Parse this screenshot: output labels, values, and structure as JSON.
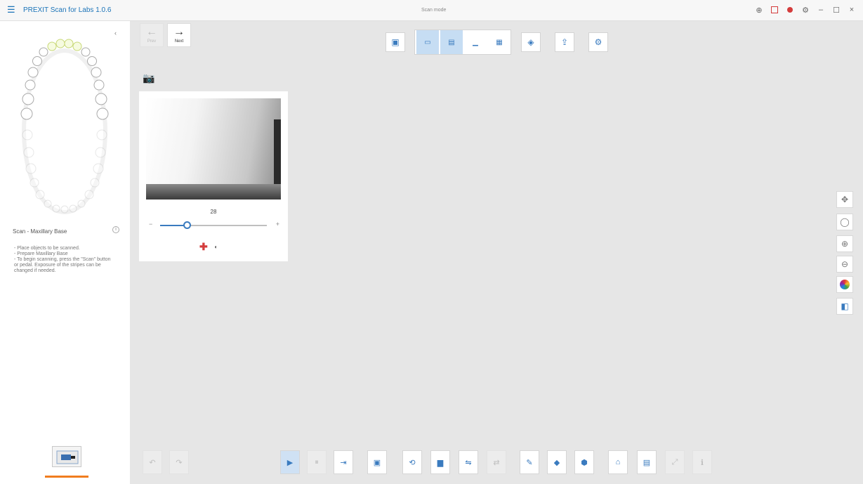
{
  "titlebar": {
    "app_title": "PREXIT Scan for Labs 1.0.6",
    "center_title": "Scan mode"
  },
  "left_panel": {
    "scan_title": "Scan - Maxillary Base",
    "instructions": [
      "Place objects to be scanned.",
      "Prepare Maxillary Base",
      "To begin scanning, press the \"Scan\" button or pedal. Exposure of the stripes can be changed if needed."
    ]
  },
  "navigation": {
    "back_label": "Prev",
    "next_label": "Next"
  },
  "camera_preview": {
    "exposure_value": "28",
    "exposure_fraction": 0.25
  },
  "icons": {
    "menu": "menu-icon",
    "camera": "camera-icon",
    "crosshair": "crosshair-icon",
    "color": "color-wheel-icon"
  },
  "colors": {
    "accent": "#3a7bbf",
    "record": "#d43c3c",
    "progress": "#f07d1f"
  }
}
